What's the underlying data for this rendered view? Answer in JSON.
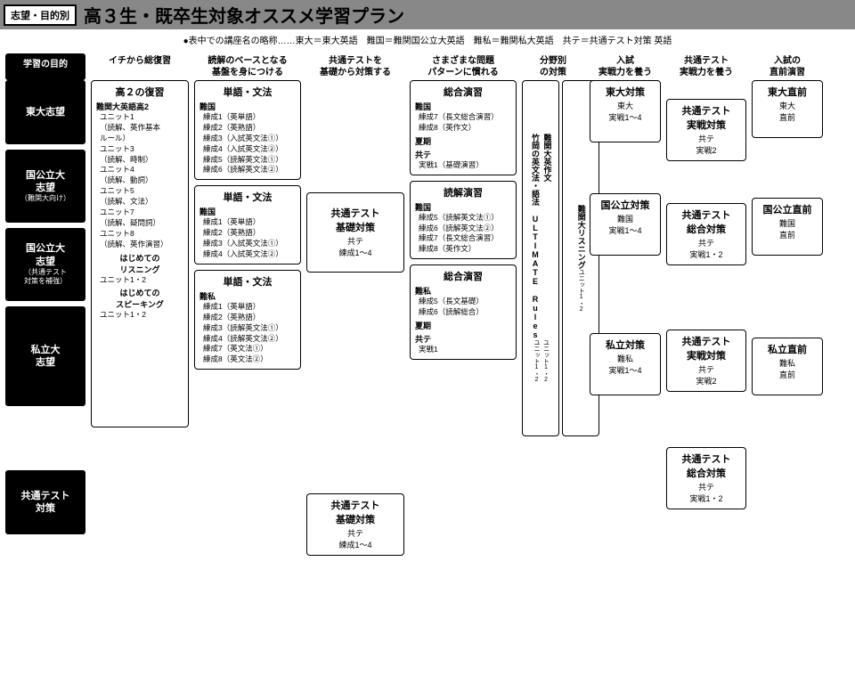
{
  "header": {
    "tag": "志望・目的別",
    "title": "高３生・既卒生対象オススメ学習プラン",
    "note": "●表中での講座名の略称……東大＝東大英語　難国＝難関国公立大英語　難私＝難関私大英語　共テ＝共通テスト対策 英語"
  },
  "row_header_label": "学習の目的",
  "col_headers": [
    "イチから総復習",
    "読解のベースとなる\n基盤を身につける",
    "共通テストを\n基礎から対策する",
    "さまざまな問題\nパターンに慣れる",
    "分野別\nの対策",
    "入試\n実戦力を養う",
    "共通テスト\n実戦力を養う",
    "入試の\n直前演習"
  ],
  "left_tags": [
    {
      "main": "東大志望",
      "sub": ""
    },
    {
      "main": "国公立大\n志望",
      "sub": "（難関大向け）"
    },
    {
      "main": "国公立大\n志望",
      "sub": "（共通テスト\n対策を補強）"
    },
    {
      "main": "私立大\n志望",
      "sub": ""
    },
    {
      "main": "共通テスト\n対策",
      "sub": ""
    }
  ],
  "review_box": {
    "title": "高２の復習",
    "sub": "難関大英語高2",
    "items": [
      "ユニット1",
      "（読解、英作基本\nルール）",
      "ユニット3",
      "（読解、時制）",
      "ユニット4",
      "（読解、動詞）",
      "ユニット5",
      "（読解、文法）",
      "ユニット7",
      "（読解、疑問詞）",
      "ユニット8",
      "（読解、英作演習）"
    ],
    "extra_title1": "はじめての\nリスニング",
    "extra1": "ユニット1・2",
    "extra_title2": "はじめての\nスピーキング",
    "extra2": "ユニット1・2"
  },
  "grammar_boxes": [
    {
      "title": "単語・文法",
      "sub": "難国",
      "items": [
        "練成1（英単語）",
        "練成2（英熟語）",
        "練成3（入試英文法①）",
        "練成4（入試英文法②）",
        "練成5（読解英文法①）",
        "練成6（読解英文法②）"
      ]
    },
    {
      "title": "単語・文法",
      "sub": "難国",
      "items": [
        "練成1（英単語）",
        "練成2（英熟語）",
        "練成3（入試英文法①）",
        "練成4（入試英文法②）"
      ]
    },
    {
      "title": "単語・文法",
      "sub": "難私",
      "items": [
        "練成1（英単語）",
        "練成2（英熟語）",
        "練成3（読解英文法①）",
        "練成4（読解英文法②）",
        "練成7（英文法①）",
        "練成8（英文法②）"
      ]
    }
  ],
  "kyote_basic": {
    "title": "共通テスト\n基礎対策",
    "sub": "共テ",
    "line": "練成1〜4"
  },
  "practice_boxes": [
    {
      "title": "総合演習",
      "sub": "難国",
      "items": [
        "練成7（長文総合演習）",
        "練成8（英作文）"
      ],
      "sub2": "夏期",
      "sub3": "共テ",
      "line3": "実戦1（基礎演習）"
    },
    {
      "title": "読解演習",
      "sub": "難国",
      "items": [
        "練成5（読解英文法①）",
        "練成6（読解英文法②）",
        "練成7（長文総合演習）",
        "練成8（英作文）"
      ]
    },
    {
      "title": "総合演習",
      "sub": "難私",
      "items": [
        "練成5（長文基礎）",
        "練成6（読解総合）"
      ],
      "sub2": "夏期",
      "sub3": "共テ",
      "line3": "実戦1"
    }
  ],
  "field_boxes": [
    {
      "t": "難関大英作文\n竹岡の英文法・語法 ULTIMATE Rules",
      "s": "ユニット1・2\nユニット1・2"
    },
    {
      "t": "難関大リスニング",
      "s": "ユニット1・2"
    }
  ],
  "univ_boxes": [
    {
      "title": "東大対策",
      "sub": "東大",
      "line": "実戦1〜4"
    },
    {
      "title": "国公立対策",
      "sub": "難国",
      "line": "実戦1〜4"
    },
    {
      "title": "私立対策",
      "sub": "難私",
      "line": "実戦1〜4"
    }
  ],
  "kyote_boxes": [
    {
      "title": "共通テスト\n実戦対策",
      "sub": "共テ",
      "line": "実戦2"
    },
    {
      "title": "共通テスト\n総合対策",
      "sub": "共テ",
      "line": "実戦1・2"
    },
    {
      "title": "共通テスト\n実戦対策",
      "sub": "共テ",
      "line": "実戦2"
    }
  ],
  "final_boxes": [
    {
      "title": "東大直前",
      "sub": "東大",
      "line": "直前"
    },
    {
      "title": "国公立直前",
      "sub": "難国",
      "line": "直前"
    },
    {
      "title": "私立直前",
      "sub": "難私",
      "line": "直前"
    }
  ],
  "bottom_row": {
    "kyote_basic": {
      "title": "共通テスト\n基礎対策",
      "sub": "共テ",
      "line": "練成1〜4"
    },
    "kyote_total": {
      "title": "共通テスト\n総合対策",
      "sub": "共テ",
      "line": "実戦1・2"
    }
  }
}
